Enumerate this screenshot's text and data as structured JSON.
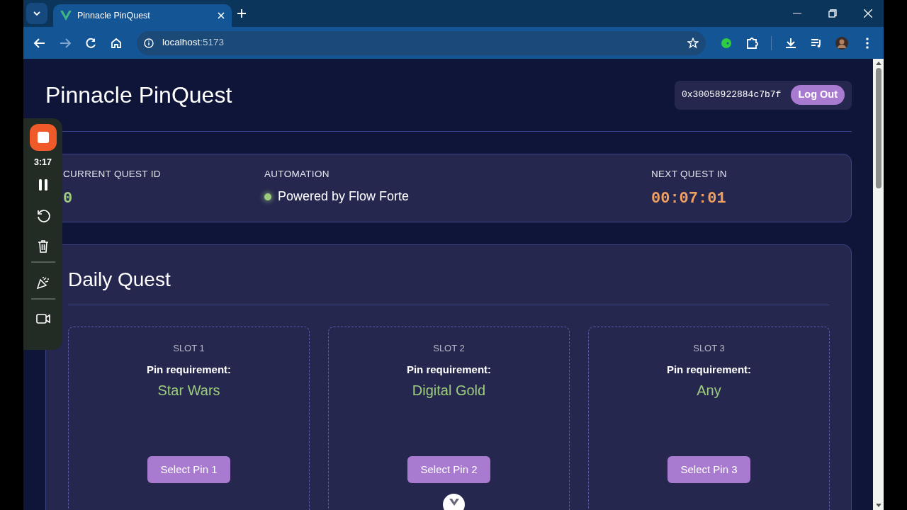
{
  "browser": {
    "tab_title": "Pinnacle PinQuest",
    "url_host": "localhost",
    "url_port": ":5173"
  },
  "recorder": {
    "time": "3:17"
  },
  "header": {
    "title": "Pinnacle PinQuest",
    "wallet_address": "0x30058922884c7b7f",
    "logout_label": "Log Out"
  },
  "stats": [
    {
      "kind": "id",
      "label": "CURRENT QUEST ID",
      "value": "0"
    },
    {
      "kind": "status",
      "label": "AUTOMATION",
      "value": "Powered by Flow Forte",
      "active": true
    },
    {
      "kind": "timer",
      "label": "NEXT QUEST IN",
      "value": "00:07:01"
    }
  ],
  "daily_quest": {
    "title": "Daily Quest",
    "slots": [
      {
        "label": "SLOT 1",
        "requirement_label": "Pin requirement:",
        "requirement": "Star Wars",
        "button": "Select Pin 1"
      },
      {
        "label": "SLOT 2",
        "requirement_label": "Pin requirement:",
        "requirement": "Digital Gold",
        "button": "Select Pin 2"
      },
      {
        "label": "SLOT 3",
        "requirement_label": "Pin requirement:",
        "requirement": "Any",
        "button": "Select Pin 3"
      }
    ]
  }
}
